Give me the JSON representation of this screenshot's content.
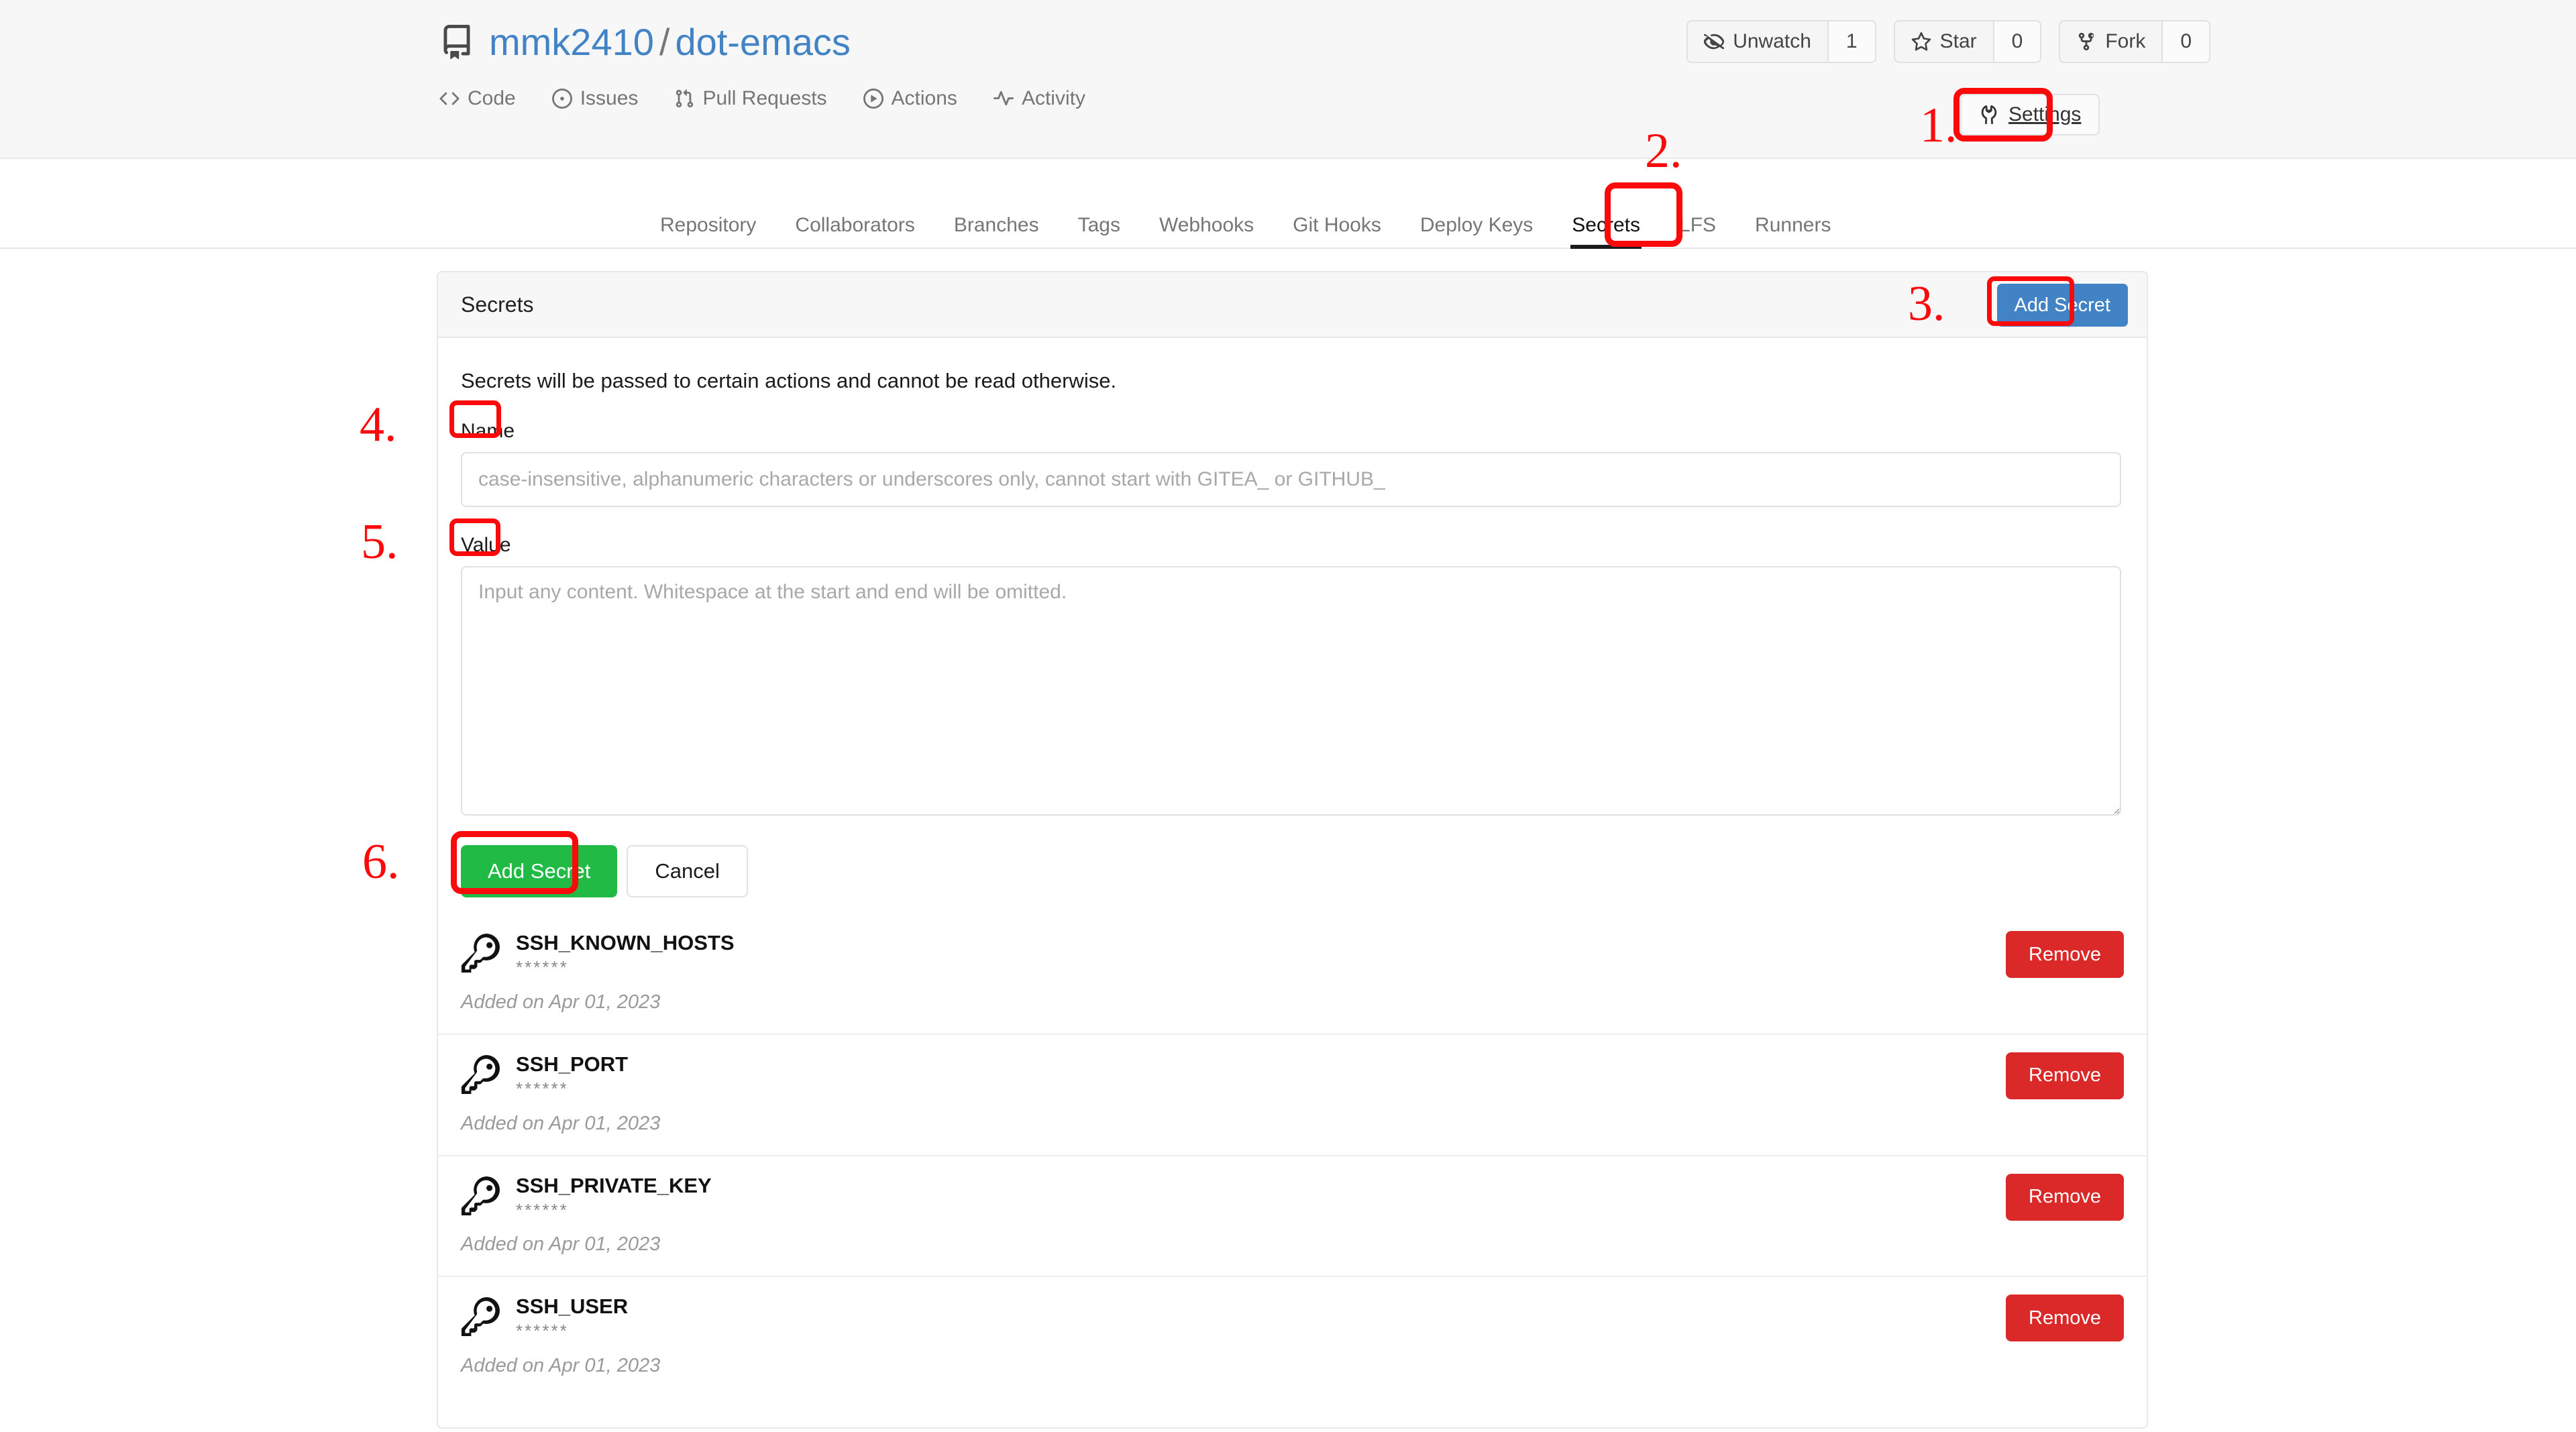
{
  "repo": {
    "owner": "mmk2410",
    "separator": "/",
    "name": "dot-emacs",
    "icon": "repo-book-icon"
  },
  "header_actions": [
    {
      "label": "Unwatch",
      "count": "1",
      "icon": "eye-closed-icon",
      "name": "unwatch-button"
    },
    {
      "label": "Star",
      "count": "0",
      "icon": "star-icon",
      "name": "star-button"
    },
    {
      "label": "Fork",
      "count": "0",
      "icon": "fork-icon",
      "name": "fork-button"
    }
  ],
  "repo_nav": [
    {
      "label": "Code",
      "icon": "code-icon"
    },
    {
      "label": "Issues",
      "icon": "issue-opened-icon"
    },
    {
      "label": "Pull Requests",
      "icon": "git-pull-request-icon"
    },
    {
      "label": "Actions",
      "icon": "play-circle-icon"
    },
    {
      "label": "Activity",
      "icon": "pulse-icon"
    }
  ],
  "settings_button": {
    "label": "Settings",
    "icon": "wrench-icon"
  },
  "settings_nav": [
    {
      "label": "Repository",
      "active": false
    },
    {
      "label": "Collaborators",
      "active": false
    },
    {
      "label": "Branches",
      "active": false
    },
    {
      "label": "Tags",
      "active": false
    },
    {
      "label": "Webhooks",
      "active": false
    },
    {
      "label": "Git Hooks",
      "active": false
    },
    {
      "label": "Deploy Keys",
      "active": false
    },
    {
      "label": "Secrets",
      "active": true
    },
    {
      "label": "LFS",
      "active": false
    },
    {
      "label": "Runners",
      "active": false
    }
  ],
  "panel": {
    "title": "Secrets",
    "add_button_label": "Add Secret",
    "description": "Secrets will be passed to certain actions and cannot be read otherwise."
  },
  "form": {
    "name_label": "Name",
    "name_value": "",
    "name_placeholder": "case-insensitive, alphanumeric characters or underscores only, cannot start with GITEA_ or GITHUB_",
    "value_label": "Value",
    "value_value": "",
    "value_placeholder": "Input any content. Whitespace at the start and end will be omitted.",
    "submit_label": "Add Secret",
    "cancel_label": "Cancel"
  },
  "secrets": [
    {
      "name": "SSH_KNOWN_HOSTS",
      "masked": "******",
      "added": "Added on Apr 01, 2023",
      "remove_label": "Remove",
      "icon": "key-icon"
    },
    {
      "name": "SSH_PORT",
      "masked": "******",
      "added": "Added on Apr 01, 2023",
      "remove_label": "Remove",
      "icon": "key-icon"
    },
    {
      "name": "SSH_PRIVATE_KEY",
      "masked": "******",
      "added": "Added on Apr 01, 2023",
      "remove_label": "Remove",
      "icon": "key-icon"
    },
    {
      "name": "SSH_USER",
      "masked": "******",
      "added": "Added on Apr 01, 2023",
      "remove_label": "Remove",
      "icon": "key-icon"
    }
  ],
  "annotations": {
    "color": "#fa0a0a",
    "steps": [
      {
        "number": "1.",
        "target": "settings-button"
      },
      {
        "number": "2.",
        "target": "secrets-tab"
      },
      {
        "number": "3.",
        "target": "add-secret-header-button"
      },
      {
        "number": "4.",
        "target": "name-label"
      },
      {
        "number": "5.",
        "target": "value-label"
      },
      {
        "number": "6.",
        "target": "add-secret-submit-button"
      }
    ]
  },
  "colors": {
    "link_blue": "#4183c4",
    "button_blue": "#4183c4",
    "button_green": "#21ba45",
    "button_red": "#db2828",
    "annotation_red": "#fa0a0a",
    "header_bg": "#f7f7f8",
    "border": "#e8e8ea"
  }
}
